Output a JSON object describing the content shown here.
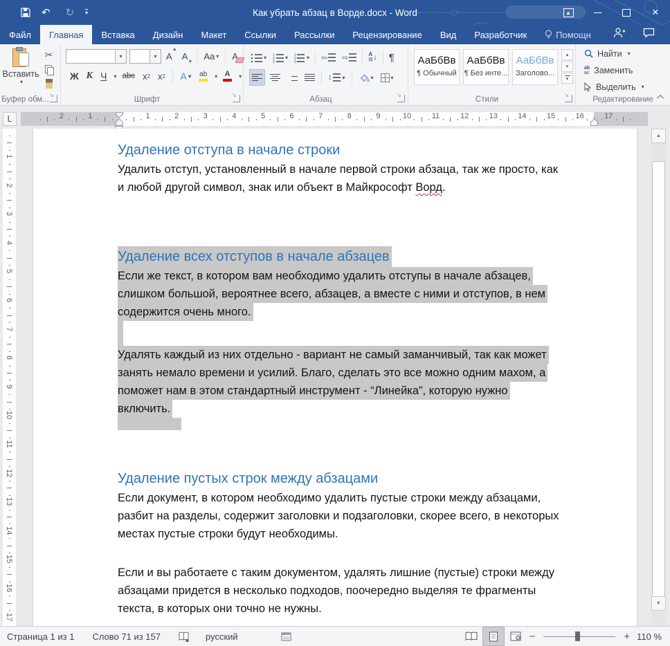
{
  "window": {
    "title": "Как убрать абзац в Ворде.docx - Word",
    "quick_access": {
      "save": "save",
      "undo": "undo",
      "redo": "redo",
      "customize": "customize-quick-access"
    },
    "controls": {
      "ribbon_display": "ribbon-display-options",
      "minimize": "minimize",
      "maximize": "maximize",
      "close": "close"
    }
  },
  "tabs": {
    "items": [
      {
        "id": "file",
        "label": "Файл",
        "active": false
      },
      {
        "id": "home",
        "label": "Главная",
        "active": true
      },
      {
        "id": "insert",
        "label": "Вставка",
        "active": false
      },
      {
        "id": "design",
        "label": "Дизайн",
        "active": false
      },
      {
        "id": "layout",
        "label": "Макет",
        "active": false
      },
      {
        "id": "references",
        "label": "Ссылки",
        "active": false
      },
      {
        "id": "mailings",
        "label": "Рассылки",
        "active": false
      },
      {
        "id": "review",
        "label": "Рецензирование",
        "active": false
      },
      {
        "id": "view",
        "label": "Вид",
        "active": false
      },
      {
        "id": "developer",
        "label": "Разработчик",
        "active": false
      },
      {
        "id": "tellme",
        "label": "Помощн",
        "active": false,
        "bulb": true
      }
    ]
  },
  "ribbon": {
    "clipboard": {
      "paste": "Вставить",
      "label": "Буфер обм..."
    },
    "font": {
      "label": "Шрифт",
      "bold": "Ж",
      "italic": "К",
      "underline": "Ч",
      "strike": "abc",
      "subscript": "x",
      "superscript": "x",
      "grow": "А",
      "shrink": "А",
      "case": "Aa",
      "clear": "А",
      "effects": "А",
      "highlight": "ab",
      "color": "А",
      "highlight_color": "#ffe400",
      "font_color": "#e00000"
    },
    "paragraph": {
      "label": "Абзац",
      "sort_a": "А",
      "sort_b": "Я",
      "pilcrow": "¶"
    },
    "styles": {
      "label": "Стили",
      "items": [
        {
          "preview": "АаБбВв",
          "name": "¶ Обычный"
        },
        {
          "preview": "АаБбВв",
          "name": "¶ Без инте..."
        },
        {
          "preview": "АаБбВв",
          "name": "Заголово...",
          "heading": true
        }
      ]
    },
    "editing": {
      "label": "Редактирование",
      "find": "Найти",
      "replace": "Заменить",
      "select": "Выделить"
    }
  },
  "ruler": {
    "h_left_numbers": [
      "3",
      "2",
      "1"
    ],
    "h_numbers": [
      "1",
      "2",
      "3",
      "4",
      "5",
      "6",
      "7",
      "8",
      "9",
      "10",
      "11",
      "12",
      "13",
      "14",
      "15",
      "16"
    ],
    "h_right_number": "17",
    "v_numbers": [
      "1",
      "2",
      "3",
      "4",
      "5",
      "6",
      "7",
      "8",
      "9",
      "10",
      "11",
      "12",
      "13",
      "14",
      "15",
      "16"
    ],
    "tab_selector": "L"
  },
  "document": {
    "blocks": [
      {
        "type": "h",
        "mt": 16,
        "text": "Удаление отступа в начале строки"
      },
      {
        "type": "p",
        "lines": [
          {
            "text": "Удалить отступ, установленный в начале первой строки абзаца, так же просто, как"
          },
          {
            "pre": "и любой другой символ, знак или объект в Майкрософт ",
            "spell": "Ворд",
            "post": "."
          }
        ]
      },
      {
        "type": "h",
        "mt": 72,
        "sel": true,
        "text": "Удаление всех отступов в начале абзацев"
      },
      {
        "type": "p",
        "lines": [
          {
            "text": "Если же текст, в котором вам необходимо удалить отступы в начале абзацев,",
            "sel": true
          },
          {
            "text": "слишком большой, вероятнее всего, абзацев, а вместе с ними и отступов, в нем",
            "sel": true
          },
          {
            "text": "содержится очень много.",
            "sel": true
          }
        ]
      },
      {
        "type": "strip",
        "h": 36,
        "w": 8
      },
      {
        "type": "p",
        "lines": [
          {
            "text": "Удалять каждый из них отдельно - вариант не самый заманчивый, так как может",
            "sel": true
          },
          {
            "text": "занять немало времени и усилий. Благо, сделать это все можно одним махом, а",
            "sel": true
          },
          {
            "text": "поможет нам в этом стандартный инструмент - “Линейка”, которую нужно",
            "sel": true
          },
          {
            "text": "включить.",
            "sel": true
          }
        ]
      },
      {
        "type": "strip",
        "h": 18,
        "w": 92
      },
      {
        "type": "h",
        "mt": 55,
        "text": "Удаление пустых строк между абзацами"
      },
      {
        "type": "p",
        "lines": [
          {
            "text": "Если документ, в котором необходимо удалить пустые строки между абзацами,"
          },
          {
            "text": "разбит на разделы, содержит заголовки и подзаголовки, скорее всего, в некоторых"
          },
          {
            "text": "местах пустые строки будут необходимы."
          }
        ]
      },
      {
        "type": "p",
        "mt": 30,
        "lines": [
          {
            "text": "Если и вы работаете с таким документом, удалять лишние (пустые) строки между"
          },
          {
            "text": "абзацами придется в несколько подходов, поочередно выделяя те фрагменты"
          },
          {
            "text": "текста, в которых они точно не нужны."
          }
        ]
      }
    ]
  },
  "status": {
    "page": "Страница 1 из 1",
    "words": "Слово 71 из 157",
    "language": "русский",
    "zoom": "110 %"
  },
  "colors": {
    "titlebar": "#2b579a",
    "heading": "#2e74b5",
    "selection": "#c8c8c8",
    "ribbon_bg": "#f4f5f7"
  }
}
